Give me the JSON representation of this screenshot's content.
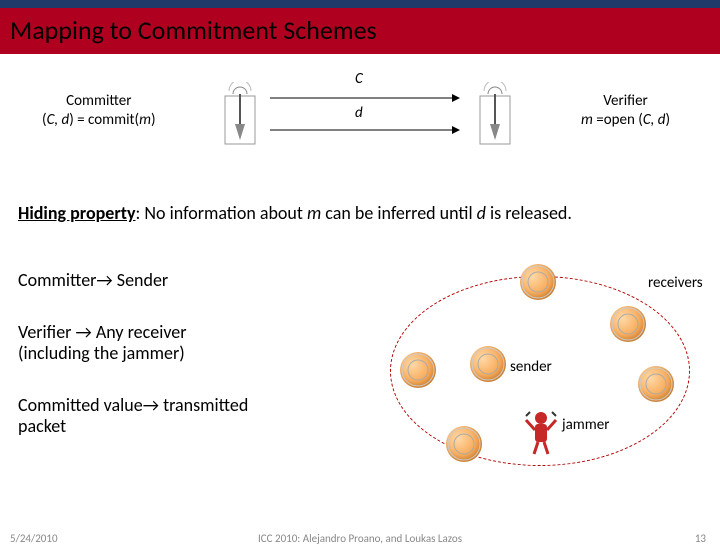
{
  "title": "Mapping to Commitment Schemes",
  "diagram": {
    "committer_label_line1": "Committer",
    "committer_label_line2": "(C, d) = commit(m)",
    "verifier_label_line1": "Verifier",
    "verifier_label_line2": "m =open (C, d)",
    "arrow_top_label": "C",
    "arrow_bottom_label": "d"
  },
  "hiding_property": {
    "lead": "Hiding property",
    "rest": ":  No information about ",
    "m": "m",
    "tail": " can be inferred until ",
    "d": "d",
    "tail2": " is released."
  },
  "mappings": {
    "row1": "Committer→ Sender",
    "row2": "Verifier → Any receiver (including the jammer)",
    "row3": "Committed value→ transmitted packet"
  },
  "network": {
    "receivers_label": "receivers",
    "sender_label": "sender",
    "jammer_label": "jammer"
  },
  "footer": {
    "date": "5/24/2010",
    "center": "ICC 2010:  Alejandro Proano, and Loukas Lazos",
    "page": "13"
  }
}
